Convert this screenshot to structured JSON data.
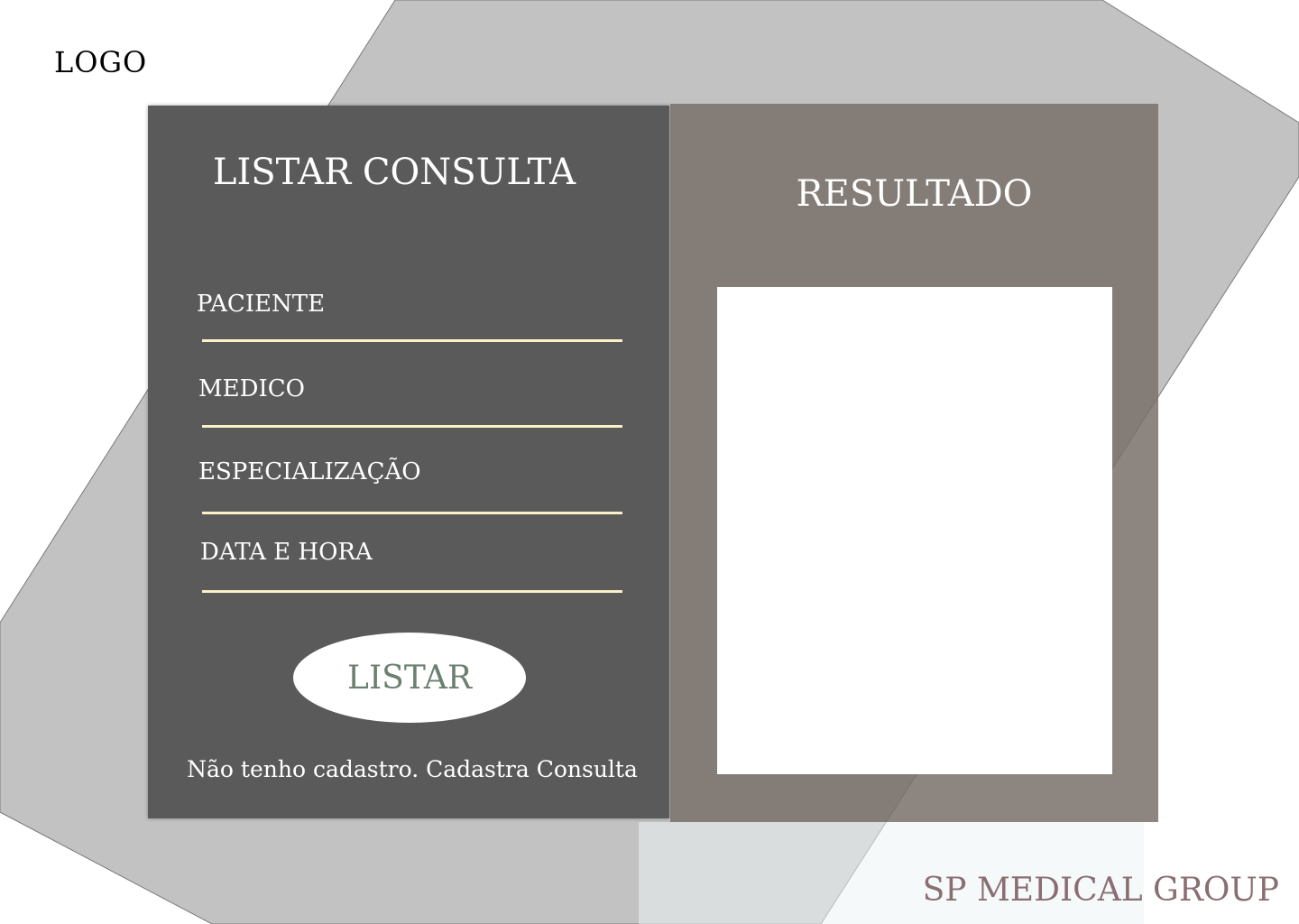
{
  "header": {
    "logo_text": "LOGO"
  },
  "form": {
    "title": "LISTAR CONSULTA",
    "fields": [
      {
        "label": "PACIENTE"
      },
      {
        "label": "MEDICO"
      },
      {
        "label": "ESPECIALIZAÇÃO"
      },
      {
        "label": "DATA E HORA"
      }
    ],
    "submit_label": "LISTAR",
    "signup_link": "Não tenho cadastro. Cadastra Consulta"
  },
  "results": {
    "title": "RESULTADO"
  },
  "footer": {
    "brand": "SP MEDICAL GROUP"
  },
  "colors": {
    "background_shape": "#c2c2c2",
    "form_panel": "#5a5a5a",
    "result_panel": "#86807a",
    "field_underline": "#fbf0c8",
    "button_text": "#6b8070",
    "brand_text": "#8a6e72"
  }
}
